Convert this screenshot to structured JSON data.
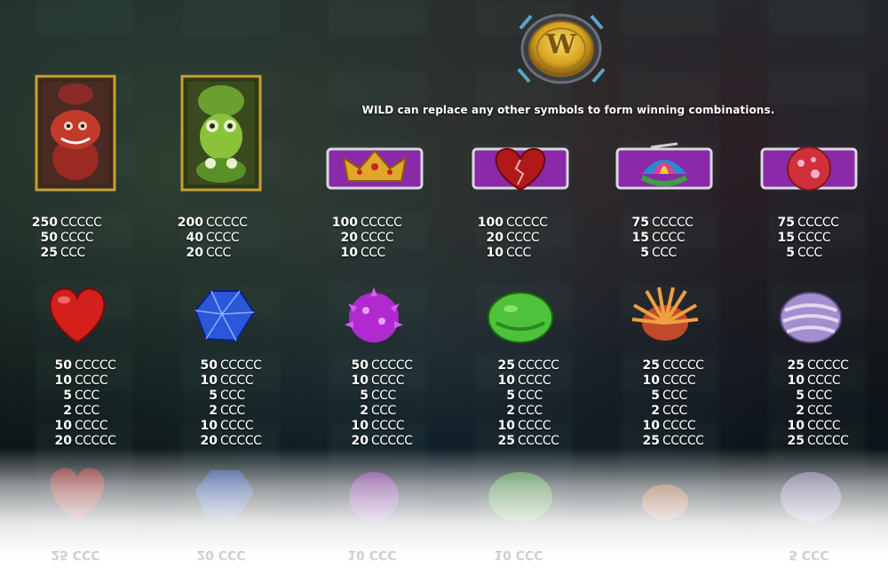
{
  "wild": {
    "badge_letter": "W",
    "description": "WILD can replace any other symbols to form winning combinations."
  },
  "row1": [
    {
      "symbol": "red-monster-icon",
      "pays": [
        {
          "value": "250",
          "combo": "CCCCC"
        },
        {
          "value": "50",
          "combo": "CCCC"
        },
        {
          "value": "25",
          "combo": "CCC"
        }
      ]
    },
    {
      "symbol": "green-alien-icon",
      "pays": [
        {
          "value": "200",
          "combo": "CCCCC"
        },
        {
          "value": "40",
          "combo": "CCCC"
        },
        {
          "value": "20",
          "combo": "CCC"
        }
      ]
    },
    {
      "symbol": "crown-icon",
      "pays": [
        {
          "value": "100",
          "combo": "CCCCC"
        },
        {
          "value": "20",
          "combo": "CCCC"
        },
        {
          "value": "10",
          "combo": "CCC"
        }
      ]
    },
    {
      "symbol": "broken-heart-icon",
      "pays": [
        {
          "value": "100",
          "combo": "CCCCC"
        },
        {
          "value": "20",
          "combo": "CCCC"
        },
        {
          "value": "10",
          "combo": "CCC"
        }
      ]
    },
    {
      "symbol": "propeller-cap-icon",
      "pays": [
        {
          "value": "75",
          "combo": "CCCCC"
        },
        {
          "value": "15",
          "combo": "CCCC"
        },
        {
          "value": "5",
          "combo": "CCC"
        }
      ]
    },
    {
      "symbol": "spotted-egg-icon",
      "pays": [
        {
          "value": "75",
          "combo": "CCCCC"
        },
        {
          "value": "15",
          "combo": "CCCC"
        },
        {
          "value": "5",
          "combo": "CCC"
        }
      ]
    }
  ],
  "row2": [
    {
      "symbol": "red-heart-icon",
      "pays": [
        {
          "value": "50",
          "combo": "CCCCC"
        },
        {
          "value": "10",
          "combo": "CCCC"
        },
        {
          "value": "5",
          "combo": "CCC"
        },
        {
          "value": "2",
          "combo": "CCC"
        },
        {
          "value": "10",
          "combo": "CCCC"
        },
        {
          "value": "20",
          "combo": "CCCCC"
        }
      ]
    },
    {
      "symbol": "blue-gem-icon",
      "pays": [
        {
          "value": "50",
          "combo": "CCCCC"
        },
        {
          "value": "10",
          "combo": "CCCC"
        },
        {
          "value": "5",
          "combo": "CCC"
        },
        {
          "value": "2",
          "combo": "CCC"
        },
        {
          "value": "10",
          "combo": "CCCC"
        },
        {
          "value": "20",
          "combo": "CCCCC"
        }
      ]
    },
    {
      "symbol": "purple-spiky-icon",
      "pays": [
        {
          "value": "50",
          "combo": "CCCCC"
        },
        {
          "value": "10",
          "combo": "CCCC"
        },
        {
          "value": "5",
          "combo": "CCC"
        },
        {
          "value": "2",
          "combo": "CCC"
        },
        {
          "value": "10",
          "combo": "CCCC"
        },
        {
          "value": "20",
          "combo": "CCCCC"
        }
      ]
    },
    {
      "symbol": "green-blob-icon",
      "pays": [
        {
          "value": "25",
          "combo": "CCCCC"
        },
        {
          "value": "10",
          "combo": "CCCC"
        },
        {
          "value": "5",
          "combo": "CCC"
        },
        {
          "value": "2",
          "combo": "CCC"
        },
        {
          "value": "10",
          "combo": "CCCC"
        },
        {
          "value": "25",
          "combo": "CCCCC"
        }
      ]
    },
    {
      "symbol": "orange-fur-icon",
      "pays": [
        {
          "value": "25",
          "combo": "CCCCC"
        },
        {
          "value": "10",
          "combo": "CCCC"
        },
        {
          "value": "5",
          "combo": "CCC"
        },
        {
          "value": "2",
          "combo": "CCC"
        },
        {
          "value": "10",
          "combo": "CCCC"
        },
        {
          "value": "25",
          "combo": "CCCCC"
        }
      ]
    },
    {
      "symbol": "lavender-swirl-icon",
      "pays": [
        {
          "value": "25",
          "combo": "CCCCC"
        },
        {
          "value": "10",
          "combo": "CCCC"
        },
        {
          "value": "5",
          "combo": "CCC"
        },
        {
          "value": "2",
          "combo": "CCC"
        },
        {
          "value": "10",
          "combo": "CCCC"
        },
        {
          "value": "25",
          "combo": "CCCCC"
        }
      ]
    }
  ],
  "reflection": [
    "25 CCC",
    "20 CCC",
    "10 CCC",
    "10 CCC",
    "",
    "5 CCC"
  ],
  "colors": {
    "gold": "#d9a521",
    "purple_plaque": "#8a2aa8",
    "heart_red": "#d4201a",
    "gem_blue": "#2a58d8",
    "spiky_purple": "#b02ad0",
    "blob_green": "#4ec23a",
    "fur_orange": "#f08a2a",
    "swirl_lavender": "#a48ed0"
  }
}
